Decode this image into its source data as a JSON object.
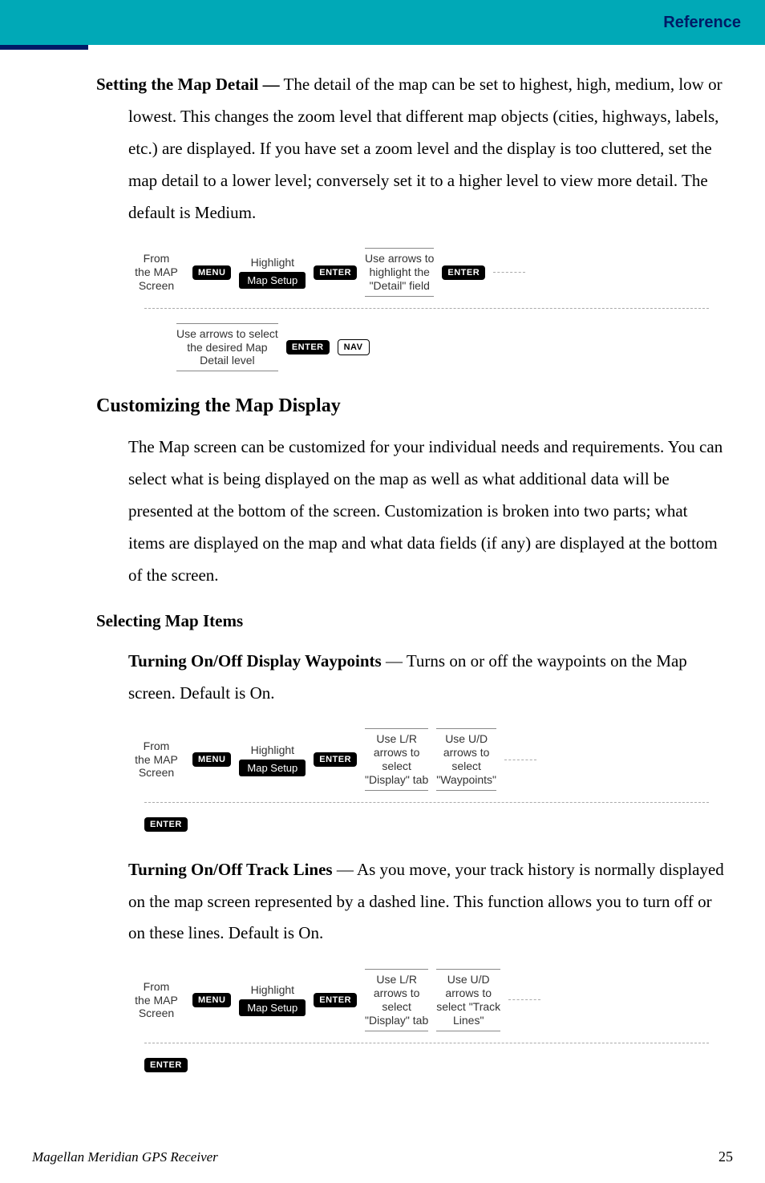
{
  "header": {
    "section_label": "Reference"
  },
  "para1": {
    "lead": "Setting the Map Detail —",
    "text": " The detail of the map can be set to highest, high, medium, low or lowest. This changes the zoom level that different map objects (cities, highways, labels, etc.) are displayed.  If you have set a zoom level and the display is too cluttered, set the map detail to a lower level; conversely set it to a higher level to view more detail.  The default is Medium."
  },
  "keys": {
    "menu": "MENU",
    "enter": "ENTER",
    "nav": "NAV"
  },
  "flow1": {
    "s1a": "From",
    "s1b": "the MAP",
    "s1c": "Screen",
    "s2a": "Highlight",
    "s2b": "Map Setup",
    "s3a": "Use arrows to",
    "s3b": "highlight the",
    "s3c": "\"Detail\" field",
    "s4a": "Use arrows to select",
    "s4b": "the desired Map",
    "s4c": "Detail level"
  },
  "h2": "Customizing the Map Display",
  "para2": "The Map screen can be customized for your individual needs and requirements.  You can select what is being displayed on the map as well as what additional data will be presented at the bottom of the screen.  Customization is broken into two parts; what items are displayed on the map and what data fields (if any) are displayed at the bottom of the screen.",
  "h3": "Selecting Map Items",
  "para3": {
    "lead": "Turning On/Off Display Waypoints",
    "text": " — Turns on or off the waypoints on the Map screen.  Default is On."
  },
  "flow2": {
    "s3a": "Use L/R",
    "s3b": "arrows to",
    "s3c": "select",
    "s3d": "\"Display\" tab",
    "s4a": "Use U/D",
    "s4b": "arrows to",
    "s4c": "select",
    "s4d": "\"Waypoints\""
  },
  "para4": {
    "lead": "Turning On/Off Track Lines",
    "text": " — As you move, your track history is normally displayed on the map screen represented by a dashed line.  This function allows you to turn off or on these lines.  Default is On."
  },
  "flow3": {
    "s4a": "Use U/D",
    "s4b": "arrows to",
    "s4c": "select \"Track",
    "s4d": "Lines\""
  },
  "footer": {
    "book": "Magellan Meridian GPS Receiver",
    "page": "25"
  }
}
